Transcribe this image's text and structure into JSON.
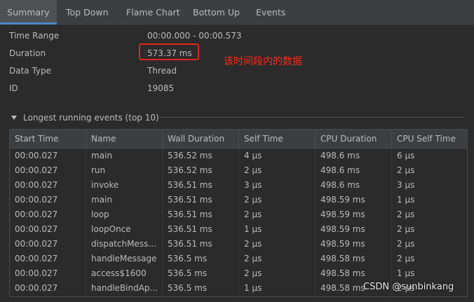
{
  "tabs": [
    {
      "label": "Summary"
    },
    {
      "label": "Top Down"
    },
    {
      "label": "Flame Chart"
    },
    {
      "label": "Bottom Up"
    },
    {
      "label": "Events"
    }
  ],
  "info": {
    "time_range_label": "Time Range",
    "time_range_value": "00:00.000 - 00:00.573",
    "duration_label": "Duration",
    "duration_value": "573.37 ms",
    "data_type_label": "Data Type",
    "data_type_value": "Thread",
    "id_label": "ID",
    "id_value": "19085"
  },
  "annotation": "该时间段内的数据",
  "section": {
    "toggle_icon": "triangle-down-icon",
    "title": "Longest running events (top 10)"
  },
  "table": {
    "columns": [
      "Start Time",
      "Name",
      "Wall Duration",
      "Self Time",
      "CPU Duration",
      "CPU Self Time"
    ],
    "rows": [
      [
        "00:00.027",
        "main",
        "536.52 ms",
        "4 μs",
        "498.6 ms",
        "6 μs"
      ],
      [
        "00:00.027",
        "run",
        "536.52 ms",
        "2 μs",
        "498.6 ms",
        "2 μs"
      ],
      [
        "00:00.027",
        "invoke",
        "536.51 ms",
        "3 μs",
        "498.6 ms",
        "3 μs"
      ],
      [
        "00:00.027",
        "main",
        "536.51 ms",
        "2 μs",
        "498.59 ms",
        "1 μs"
      ],
      [
        "00:00.027",
        "loop",
        "536.51 ms",
        "2 μs",
        "498.59 ms",
        "2 μs"
      ],
      [
        "00:00.027",
        "loopOnce",
        "536.51 ms",
        "1 μs",
        "498.59 ms",
        "2 μs"
      ],
      [
        "00:00.027",
        "dispatchMess...",
        "536.51 ms",
        "2 μs",
        "498.59 ms",
        "2 μs"
      ],
      [
        "00:00.027",
        "handleMessage",
        "536.5 ms",
        "2 μs",
        "498.58 ms",
        "2 μs"
      ],
      [
        "00:00.027",
        "access$1600",
        "536.5 ms",
        "2 μs",
        "498.58 ms",
        "1 μs"
      ],
      [
        "00:00.027",
        "handleBindAp...",
        "536.5 ms",
        "1 μs",
        "498.58 ms",
        "2 μs"
      ]
    ]
  },
  "watermark": "CSDN @sunbinkang"
}
